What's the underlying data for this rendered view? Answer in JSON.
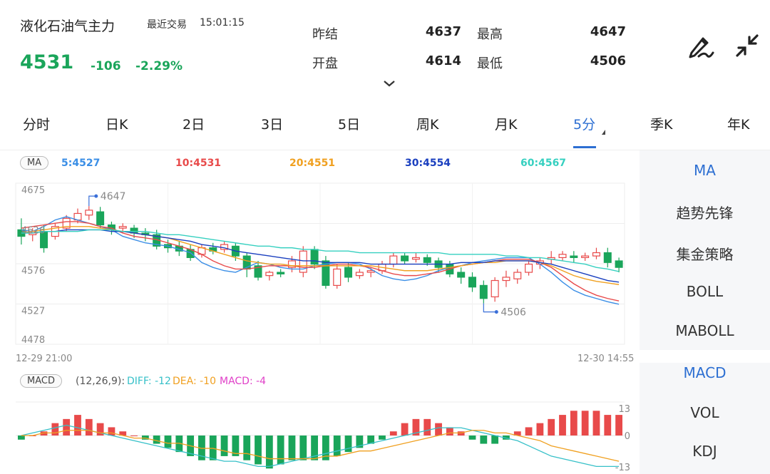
{
  "header": {
    "title": "液化石油气主力",
    "trade_label": "最近交易",
    "trade_time": "15:01:15",
    "price": "4531",
    "change": "-106",
    "change_pct": "-2.29%",
    "quote": [
      {
        "label": "昨结",
        "value": "4637"
      },
      {
        "label": "最高",
        "value": "4647"
      },
      {
        "label": "开盘",
        "value": "4614"
      },
      {
        "label": "最低",
        "value": "4506"
      }
    ]
  },
  "tabs": [
    {
      "label": "分时",
      "active": false
    },
    {
      "label": "日K",
      "active": false
    },
    {
      "label": "2日",
      "active": false
    },
    {
      "label": "3日",
      "active": false
    },
    {
      "label": "5日",
      "active": false
    },
    {
      "label": "周K",
      "active": false
    },
    {
      "label": "月K",
      "active": false
    },
    {
      "label": "5分",
      "active": true
    },
    {
      "label": "季K",
      "active": false
    },
    {
      "label": "年K",
      "active": false
    }
  ],
  "main_indicator": {
    "badge": "MA",
    "items": [
      {
        "text": "5:4527",
        "color": "#3a8ee6"
      },
      {
        "text": "10:4531",
        "color": "#e84a4a"
      },
      {
        "text": "20:4551",
        "color": "#f0a020"
      },
      {
        "text": "30:4554",
        "color": "#1a3fbf"
      },
      {
        "text": "60:4567",
        "color": "#36d0c0"
      }
    ],
    "y_ticks": [
      "4675",
      "4626",
      "4576",
      "4527",
      "4478"
    ],
    "high_label": "4647",
    "low_label": "4506",
    "x_start": "12-29 21:00",
    "x_end": "12-30 14:55"
  },
  "sub_indicator": {
    "badge": "MACD",
    "params": "(12,26,9):",
    "items": [
      {
        "text": "DIFF: -12",
        "color": "#36c0c8"
      },
      {
        "text": "DEA: -10",
        "color": "#f0a020"
      },
      {
        "text": "MACD: -4",
        "color": "#e040c8"
      }
    ],
    "y_ticks": [
      "13",
      "0",
      "-13"
    ]
  },
  "side_menu": {
    "main": [
      {
        "label": "MA",
        "active": true
      },
      {
        "label": "趋势先锋",
        "active": false
      },
      {
        "label": "集金策略",
        "active": false
      },
      {
        "label": "BOLL",
        "active": false
      },
      {
        "label": "MABOLL",
        "active": false
      }
    ],
    "sub": [
      {
        "label": "MACD",
        "active": true
      },
      {
        "label": "VOL",
        "active": false
      },
      {
        "label": "KDJ",
        "active": false
      }
    ]
  },
  "colors": {
    "up": "#e84a4a",
    "down": "#1aa55a",
    "accent": "#2d6fd2"
  },
  "chart_data": {
    "type": "candlestick",
    "price_ylim": [
      4478,
      4675
    ],
    "ma5": [
      4618,
      4616,
      4622,
      4630,
      4634,
      4630,
      4626,
      4622,
      4618,
      4610,
      4606,
      4602,
      4600,
      4598,
      4594,
      4590,
      4578,
      4572,
      4568,
      4566,
      4572,
      4578,
      4576,
      4572,
      4570,
      4570,
      4574,
      4576,
      4578,
      4578,
      4576,
      4570,
      4562,
      4558,
      4556,
      4558,
      4562,
      4568,
      4572,
      4574,
      4578,
      4580,
      4582,
      4584,
      4584,
      4584,
      4576,
      4566,
      4554,
      4544,
      4538,
      4534,
      4530,
      4527
    ],
    "ma10": [
      4620,
      4622,
      4624,
      4626,
      4628,
      4628,
      4626,
      4622,
      4620,
      4614,
      4610,
      4608,
      4606,
      4602,
      4598,
      4594,
      4588,
      4580,
      4574,
      4570,
      4570,
      4572,
      4574,
      4574,
      4574,
      4572,
      4572,
      4574,
      4576,
      4576,
      4574,
      4572,
      4568,
      4564,
      4562,
      4562,
      4564,
      4566,
      4570,
      4574,
      4576,
      4578,
      4580,
      4582,
      4582,
      4582,
      4578,
      4572,
      4562,
      4552,
      4544,
      4538,
      4534,
      4531
    ],
    "ma20": [
      4614,
      4616,
      4618,
      4620,
      4622,
      4622,
      4622,
      4620,
      4618,
      4616,
      4614,
      4612,
      4610,
      4608,
      4604,
      4600,
      4596,
      4592,
      4588,
      4584,
      4580,
      4578,
      4576,
      4576,
      4574,
      4574,
      4574,
      4574,
      4574,
      4574,
      4574,
      4574,
      4572,
      4570,
      4568,
      4568,
      4568,
      4570,
      4572,
      4574,
      4576,
      4578,
      4578,
      4580,
      4580,
      4580,
      4578,
      4574,
      4568,
      4562,
      4558,
      4555,
      4553,
      4551
    ],
    "ma30": [
      4614,
      4614,
      4616,
      4616,
      4618,
      4618,
      4618,
      4618,
      4616,
      4616,
      4614,
      4612,
      4610,
      4608,
      4606,
      4604,
      4600,
      4598,
      4596,
      4592,
      4590,
      4588,
      4586,
      4584,
      4582,
      4580,
      4580,
      4578,
      4578,
      4578,
      4578,
      4576,
      4576,
      4576,
      4576,
      4576,
      4576,
      4576,
      4576,
      4578,
      4578,
      4578,
      4580,
      4580,
      4580,
      4580,
      4578,
      4576,
      4572,
      4568,
      4564,
      4560,
      4556,
      4554
    ],
    "ma60": [
      4614,
      4614,
      4616,
      4616,
      4616,
      4616,
      4618,
      4618,
      4618,
      4616,
      4616,
      4616,
      4614,
      4612,
      4612,
      4610,
      4608,
      4606,
      4604,
      4602,
      4600,
      4598,
      4598,
      4596,
      4596,
      4594,
      4594,
      4592,
      4592,
      4592,
      4590,
      4590,
      4590,
      4590,
      4590,
      4590,
      4590,
      4590,
      4588,
      4588,
      4588,
      4588,
      4588,
      4586,
      4586,
      4584,
      4584,
      4582,
      4580,
      4578,
      4576,
      4572,
      4570,
      4567
    ],
    "candles": [
      {
        "o": 4618,
        "h": 4632,
        "c": 4610,
        "l": 4600
      },
      {
        "o": 4612,
        "h": 4620,
        "c": 4616,
        "l": 4604
      },
      {
        "o": 4616,
        "h": 4624,
        "c": 4596,
        "l": 4590
      },
      {
        "o": 4610,
        "h": 4626,
        "c": 4622,
        "l": 4606
      },
      {
        "o": 4620,
        "h": 4636,
        "c": 4632,
        "l": 4616
      },
      {
        "o": 4630,
        "h": 4644,
        "c": 4638,
        "l": 4626
      },
      {
        "o": 4636,
        "h": 4647,
        "c": 4642,
        "l": 4630
      },
      {
        "o": 4640,
        "h": 4646,
        "c": 4624,
        "l": 4620
      },
      {
        "o": 4624,
        "h": 4628,
        "c": 4618,
        "l": 4612
      },
      {
        "o": 4620,
        "h": 4626,
        "c": 4622,
        "l": 4614
      },
      {
        "o": 4620,
        "h": 4624,
        "c": 4614,
        "l": 4608
      },
      {
        "o": 4614,
        "h": 4620,
        "c": 4612,
        "l": 4604
      },
      {
        "o": 4612,
        "h": 4618,
        "c": 4598,
        "l": 4594
      },
      {
        "o": 4600,
        "h": 4606,
        "c": 4596,
        "l": 4590
      },
      {
        "o": 4598,
        "h": 4604,
        "c": 4592,
        "l": 4586
      },
      {
        "o": 4594,
        "h": 4600,
        "c": 4584,
        "l": 4580
      },
      {
        "o": 4588,
        "h": 4600,
        "c": 4596,
        "l": 4584
      },
      {
        "o": 4596,
        "h": 4602,
        "c": 4592,
        "l": 4588
      },
      {
        "o": 4594,
        "h": 4604,
        "c": 4600,
        "l": 4590
      },
      {
        "o": 4598,
        "h": 4602,
        "c": 4586,
        "l": 4580
      },
      {
        "o": 4586,
        "h": 4590,
        "c": 4570,
        "l": 4560
      },
      {
        "o": 4574,
        "h": 4580,
        "c": 4560,
        "l": 4556
      },
      {
        "o": 4562,
        "h": 4568,
        "c": 4566,
        "l": 4556
      },
      {
        "o": 4566,
        "h": 4570,
        "c": 4564,
        "l": 4560
      },
      {
        "o": 4572,
        "h": 4586,
        "c": 4580,
        "l": 4566
      },
      {
        "o": 4566,
        "h": 4598,
        "c": 4592,
        "l": 4560
      },
      {
        "o": 4594,
        "h": 4598,
        "c": 4576,
        "l": 4570
      },
      {
        "o": 4580,
        "h": 4586,
        "c": 4550,
        "l": 4546
      },
      {
        "o": 4550,
        "h": 4576,
        "c": 4570,
        "l": 4546
      },
      {
        "o": 4572,
        "h": 4578,
        "c": 4560,
        "l": 4554
      },
      {
        "o": 4562,
        "h": 4570,
        "c": 4566,
        "l": 4558
      },
      {
        "o": 4566,
        "h": 4572,
        "c": 4568,
        "l": 4560
      },
      {
        "o": 4568,
        "h": 4580,
        "c": 4576,
        "l": 4564
      },
      {
        "o": 4576,
        "h": 4590,
        "c": 4586,
        "l": 4572
      },
      {
        "o": 4586,
        "h": 4590,
        "c": 4580,
        "l": 4576
      },
      {
        "o": 4582,
        "h": 4590,
        "c": 4584,
        "l": 4578
      },
      {
        "o": 4584,
        "h": 4588,
        "c": 4578,
        "l": 4574
      },
      {
        "o": 4580,
        "h": 4584,
        "c": 4572,
        "l": 4566
      },
      {
        "o": 4576,
        "h": 4580,
        "c": 4564,
        "l": 4560
      },
      {
        "o": 4566,
        "h": 4572,
        "c": 4560,
        "l": 4552
      },
      {
        "o": 4560,
        "h": 4566,
        "c": 4548,
        "l": 4542
      },
      {
        "o": 4550,
        "h": 4556,
        "c": 4534,
        "l": 4528
      },
      {
        "o": 4536,
        "h": 4560,
        "c": 4556,
        "l": 4530
      },
      {
        "o": 4556,
        "h": 4568,
        "c": 4560,
        "l": 4548
      },
      {
        "o": 4558,
        "h": 4570,
        "c": 4566,
        "l": 4552
      },
      {
        "o": 4566,
        "h": 4580,
        "c": 4576,
        "l": 4562
      },
      {
        "o": 4576,
        "h": 4584,
        "c": 4580,
        "l": 4570
      },
      {
        "o": 4582,
        "h": 4592,
        "c": 4584,
        "l": 4576
      },
      {
        "o": 4584,
        "h": 4592,
        "c": 4588,
        "l": 4580
      },
      {
        "o": 4586,
        "h": 4592,
        "c": 4584,
        "l": 4578
      },
      {
        "o": 4584,
        "h": 4590,
        "c": 4586,
        "l": 4580
      },
      {
        "o": 4586,
        "h": 4596,
        "c": 4590,
        "l": 4582
      },
      {
        "o": 4590,
        "h": 4596,
        "c": 4578,
        "l": 4572
      },
      {
        "o": 4580,
        "h": 4584,
        "c": 4572,
        "l": 4566
      }
    ],
    "macd_ylim": [
      -13,
      13
    ],
    "macd_hist": [
      -1,
      0,
      1,
      3,
      4,
      5,
      4,
      3,
      2,
      1,
      0,
      -1,
      -2,
      -3,
      -4,
      -5,
      -6,
      -6,
      -5,
      -5,
      -6,
      -7,
      -8,
      -7,
      -6,
      -6,
      -6,
      -6,
      -5,
      -4,
      -3,
      -2,
      -1,
      1,
      3,
      4,
      4,
      3,
      2,
      1,
      -1,
      -2,
      -2,
      -1,
      1,
      2,
      3,
      4,
      5,
      6,
      6,
      6,
      5,
      5
    ],
    "diff": [
      0,
      1,
      2,
      3,
      4,
      3,
      2,
      1,
      0,
      -1,
      -2,
      -3,
      -4,
      -5,
      -6,
      -7,
      -8,
      -9,
      -10,
      -10,
      -11,
      -12,
      -12,
      -11,
      -10,
      -9,
      -8,
      -7,
      -6,
      -5,
      -4,
      -3,
      -2,
      -1,
      0,
      1,
      2,
      3,
      3,
      3,
      2,
      1,
      0,
      -1,
      -2,
      -4,
      -6,
      -8,
      -9,
      -10,
      -11,
      -12,
      -12,
      -12
    ],
    "dea": [
      0,
      0,
      1,
      1,
      2,
      2,
      2,
      1,
      1,
      0,
      -1,
      -1,
      -2,
      -3,
      -3,
      -4,
      -5,
      -5,
      -6,
      -7,
      -7,
      -8,
      -9,
      -9,
      -9,
      -9,
      -9,
      -8,
      -8,
      -7,
      -6,
      -6,
      -5,
      -4,
      -3,
      -2,
      -1,
      0,
      1,
      1,
      2,
      2,
      1,
      1,
      0,
      -1,
      -2,
      -4,
      -5,
      -6,
      -7,
      -8,
      -9,
      -10
    ]
  }
}
